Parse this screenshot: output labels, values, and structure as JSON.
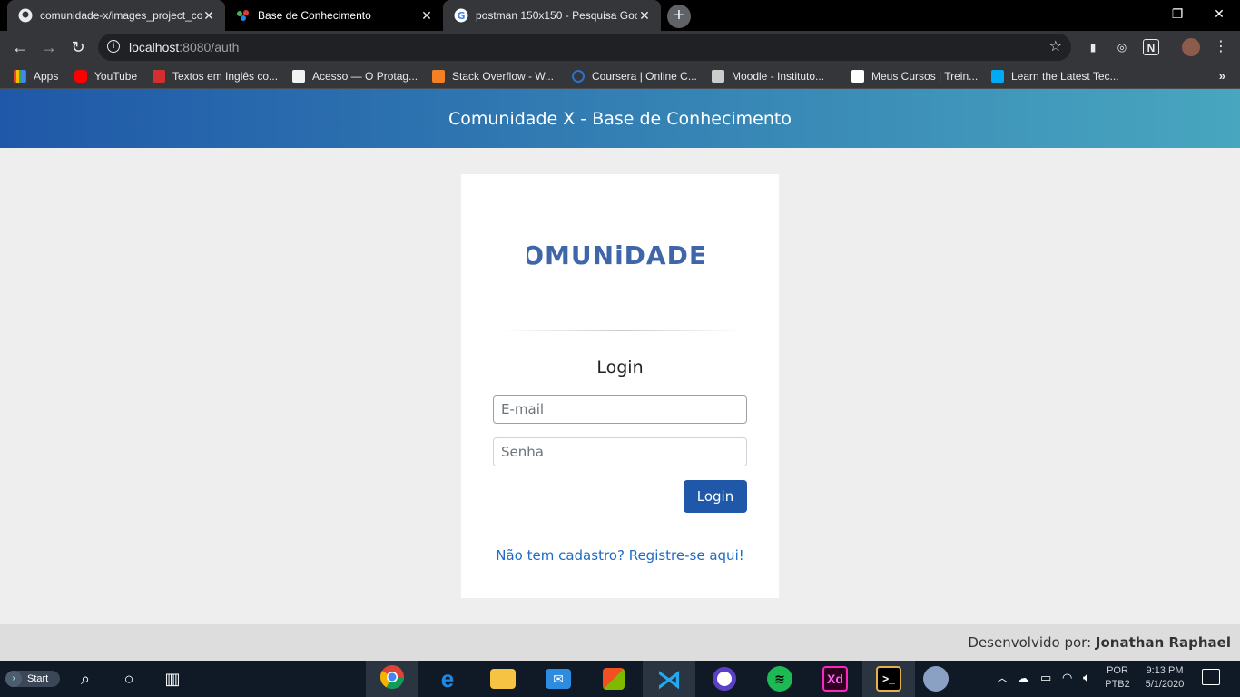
{
  "browser": {
    "tabs": [
      {
        "title": "comunidade-x/images_project_co",
        "favicon": "github-icon",
        "active": false
      },
      {
        "title": "Base de Conhecimento",
        "favicon": "app-favicon-icon",
        "active": true
      },
      {
        "title": "postman 150x150 - Pesquisa Goo",
        "favicon": "google-icon",
        "active": false
      }
    ],
    "new_tab": "+",
    "window_controls": {
      "minimize": "—",
      "restore": "❐",
      "close": "✕"
    },
    "url_host": "localhost",
    "url_path": ":8080/auth",
    "bookmarks": [
      {
        "label": "Apps",
        "color": "#ea4335"
      },
      {
        "label": "YouTube",
        "color": "#ff0000"
      },
      {
        "label": "Textos em Inglês co...",
        "color": "#d32f2f"
      },
      {
        "label": "Acesso — O Protag...",
        "color": "#ffffff"
      },
      {
        "label": "Stack Overflow - W...",
        "color": "#f48024"
      },
      {
        "label": "Coursera | Online C...",
        "color": "#2a73cc"
      },
      {
        "label": "Moodle - Instituto...",
        "color": "#cccccc"
      },
      {
        "label": "Meus Cursos | Trein...",
        "color": "#ffffff"
      },
      {
        "label": "Learn the Latest Tec...",
        "color": "#02a9f4"
      }
    ],
    "bookmarks_more": "»"
  },
  "page": {
    "header_title": "Comunidade X - Base de Conhecimento",
    "logo_text": "COMUNiDADE X",
    "login_title": "Login",
    "email_placeholder": "E-mail",
    "senha_placeholder": "Senha",
    "login_button": "Login",
    "register_link": "Não tem cadastro? Registre-se aqui!",
    "footer_prefix": "Desenvolvido por: ",
    "footer_author": "Jonathan Raphael"
  },
  "taskbar": {
    "start_label": "Start",
    "apps": [
      "chrome",
      "edge",
      "file-explorer",
      "mail",
      "store",
      "vscode",
      "app-circle",
      "spotify",
      "adobe-xd",
      "terminal",
      "app-flower"
    ],
    "lang_top": "POR",
    "lang_bottom": "PTB2",
    "time": "9:13 PM",
    "date": "5/1/2020"
  },
  "colors": {
    "header_gradient_start": "#1f58a8",
    "header_gradient_end": "#48a6bf",
    "primary": "#1f58a8",
    "link": "#1f6bc4"
  }
}
